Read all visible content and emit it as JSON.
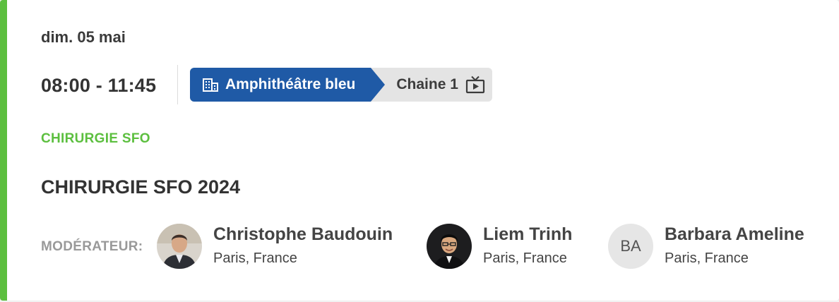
{
  "session": {
    "date": "dim. 05 mai",
    "time": "08:00 - 11:45",
    "room": {
      "label": "Amphithéâtre bleu",
      "icon": "building-icon",
      "color": "#1f5aa6"
    },
    "channel": {
      "label": "Chaine 1",
      "icon": "tv-icon"
    },
    "category": "CHIRURGIE SFO",
    "category_color": "#5cbf3f",
    "title": "CHIRURGIE SFO 2024"
  },
  "moderators": {
    "label": "MODÉRATEUR:",
    "people": [
      {
        "name": "Christophe Baudouin",
        "location": "Paris, France",
        "avatar": "photo"
      },
      {
        "name": "Liem Trinh",
        "location": "Paris, France",
        "avatar": "photo"
      },
      {
        "name": "Barbara Ameline",
        "location": "Paris, France",
        "avatar": "initials",
        "initials": "BA"
      }
    ]
  }
}
